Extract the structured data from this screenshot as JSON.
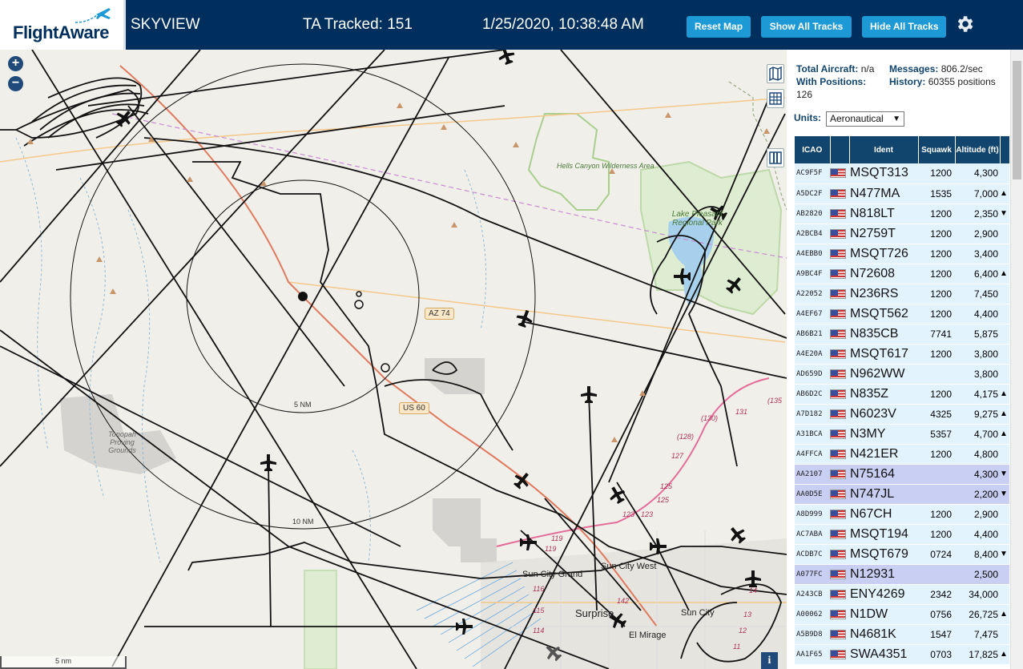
{
  "header": {
    "logo_text": "FlightAware",
    "app_title": "SKYVIEW",
    "ta_tracked": "TA Tracked: 151",
    "clock": "1/25/2020, 10:38:48 AM",
    "buttons": {
      "reset_map": "Reset Map",
      "show_all_tracks": "Show All Tracks",
      "hide_all_tracks": "Hide All Tracks"
    },
    "settings_icon": "gear-icon"
  },
  "map": {
    "zoom_in": "+",
    "zoom_out": "−",
    "labels": {
      "hells_canyon": "Hells Canyon Wilderness Area",
      "lake_pleasant": "Lake Pleasant Regional Park",
      "tonopah": "Tonopah Proving Grounds",
      "az74": "AZ 74",
      "us60": "US 60",
      "ring5": "5 NM",
      "ring10": "10 NM",
      "sun_city_grand": "Sun City Grand",
      "sun_city_west": "Sun City West",
      "sun_city": "Sun City",
      "surprise": "Surprise",
      "el_mirage": "El Mirage"
    },
    "road_numbers": [
      "131",
      "(130)",
      "(128)",
      "127",
      "125",
      "125",
      "123",
      "123",
      "119",
      "119",
      "116",
      "115",
      "114",
      "142",
      "14",
      "13",
      "12",
      "11",
      "(135"
    ],
    "scalebar": "5 nm",
    "info_button": "i",
    "tool_icons": [
      "map-icon",
      "grid-icon",
      "columns-icon"
    ]
  },
  "panel": {
    "stats": {
      "total_aircraft_label": "Total Aircraft:",
      "total_aircraft_value": "n/a",
      "with_positions_label": "With Positions:",
      "with_positions_value": "126",
      "messages_label": "Messages:",
      "messages_value": "806.2/sec",
      "history_label": "History:",
      "history_value": "60355 positions"
    },
    "units_label": "Units:",
    "units_value": "Aeronautical",
    "columns": [
      "ICAO",
      "",
      "Ident",
      "Squawk",
      "Altitude (ft)"
    ],
    "rows": [
      {
        "icao": "AC9F5F",
        "ident": "MSQT313",
        "squawk": "1200",
        "alt": "4,300",
        "trend": "",
        "selected": false
      },
      {
        "icao": "A5DC2F",
        "ident": "N477MA",
        "squawk": "1535",
        "alt": "7,000",
        "trend": "▲",
        "selected": false
      },
      {
        "icao": "AB2820",
        "ident": "N818LT",
        "squawk": "1200",
        "alt": "2,350",
        "trend": "▼",
        "selected": false
      },
      {
        "icao": "A2BCB4",
        "ident": "N2759T",
        "squawk": "1200",
        "alt": "2,900",
        "trend": "",
        "selected": false
      },
      {
        "icao": "A4EBB0",
        "ident": "MSQT726",
        "squawk": "1200",
        "alt": "3,400",
        "trend": "",
        "selected": false
      },
      {
        "icao": "A9BC4F",
        "ident": "N72608",
        "squawk": "1200",
        "alt": "6,400",
        "trend": "▲",
        "selected": false
      },
      {
        "icao": "A22052",
        "ident": "N236RS",
        "squawk": "1200",
        "alt": "7,450",
        "trend": "",
        "selected": false
      },
      {
        "icao": "A4EF67",
        "ident": "MSQT562",
        "squawk": "1200",
        "alt": "4,400",
        "trend": "",
        "selected": false
      },
      {
        "icao": "AB6B21",
        "ident": "N835CB",
        "squawk": "7741",
        "alt": "5,875",
        "trend": "",
        "selected": false
      },
      {
        "icao": "A4E20A",
        "ident": "MSQT617",
        "squawk": "1200",
        "alt": "3,800",
        "trend": "",
        "selected": false
      },
      {
        "icao": "AD659D",
        "ident": "N962WW",
        "squawk": "",
        "alt": "3,800",
        "trend": "",
        "selected": false
      },
      {
        "icao": "AB6D2C",
        "ident": "N835Z",
        "squawk": "1200",
        "alt": "4,175",
        "trend": "▲",
        "selected": false
      },
      {
        "icao": "A7D182",
        "ident": "N6023V",
        "squawk": "4325",
        "alt": "9,275",
        "trend": "▲",
        "selected": false
      },
      {
        "icao": "A31BCA",
        "ident": "N3MY",
        "squawk": "5357",
        "alt": "4,700",
        "trend": "▲",
        "selected": false
      },
      {
        "icao": "A4FFCA",
        "ident": "N421ER",
        "squawk": "1200",
        "alt": "4,800",
        "trend": "",
        "selected": false
      },
      {
        "icao": "AA2107",
        "ident": "N75164",
        "squawk": "",
        "alt": "4,300",
        "trend": "▼",
        "selected": true
      },
      {
        "icao": "AA0D5E",
        "ident": "N747JL",
        "squawk": "",
        "alt": "2,200",
        "trend": "▼",
        "selected": true
      },
      {
        "icao": "A8D999",
        "ident": "N67CH",
        "squawk": "1200",
        "alt": "2,900",
        "trend": "",
        "selected": false
      },
      {
        "icao": "AC7ABA",
        "ident": "MSQT194",
        "squawk": "1200",
        "alt": "4,400",
        "trend": "",
        "selected": false
      },
      {
        "icao": "ACDB7C",
        "ident": "MSQT679",
        "squawk": "0724",
        "alt": "8,400",
        "trend": "▼",
        "selected": false
      },
      {
        "icao": "A077FC",
        "ident": "N12931",
        "squawk": "",
        "alt": "2,500",
        "trend": "",
        "selected": true
      },
      {
        "icao": "A243CB",
        "ident": "ENY4269",
        "squawk": "2342",
        "alt": "34,000",
        "trend": "",
        "selected": false
      },
      {
        "icao": "A00062",
        "ident": "N1DW",
        "squawk": "0756",
        "alt": "26,725",
        "trend": "▲",
        "selected": false
      },
      {
        "icao": "A5B9D8",
        "ident": "N4681K",
        "squawk": "1547",
        "alt": "7,475",
        "trend": "",
        "selected": false
      },
      {
        "icao": "AA1F65",
        "ident": "SWA4351",
        "squawk": "0703",
        "alt": "17,825",
        "trend": "▲",
        "selected": false
      }
    ]
  }
}
